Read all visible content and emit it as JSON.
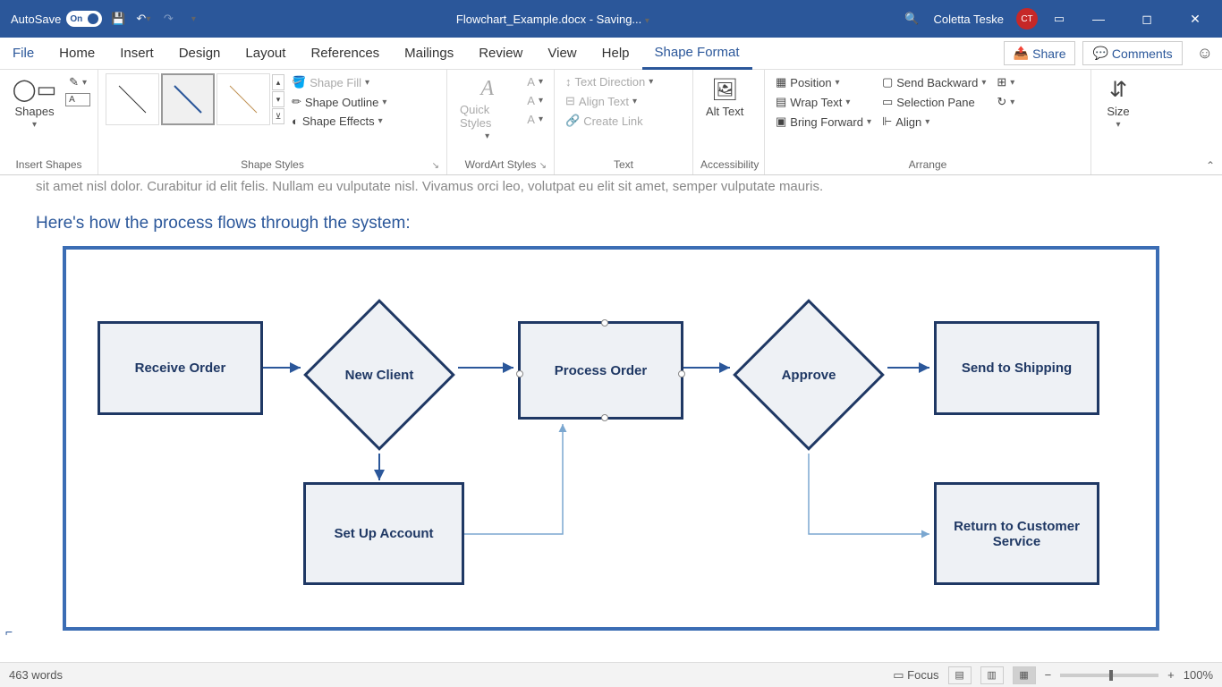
{
  "titlebar": {
    "autosave_label": "AutoSave",
    "autosave_state": "On",
    "doc_title": "Flowchart_Example.docx  -  Saving...",
    "user_name": "Coletta Teske",
    "user_initials": "CT"
  },
  "tabs": {
    "file": "File",
    "home": "Home",
    "insert": "Insert",
    "design": "Design",
    "layout": "Layout",
    "references": "References",
    "mailings": "Mailings",
    "review": "Review",
    "view": "View",
    "help": "Help",
    "shape_format": "Shape Format",
    "share": "Share",
    "comments": "Comments"
  },
  "ribbon": {
    "shapes": "Shapes",
    "insert_shapes": "Insert Shapes",
    "shape_styles": "Shape Styles",
    "shape_fill": "Shape Fill",
    "shape_outline": "Shape Outline",
    "shape_effects": "Shape Effects",
    "quick_styles": "Quick Styles",
    "wordart_styles": "WordArt Styles",
    "text_direction": "Text Direction",
    "align_text": "Align Text",
    "create_link": "Create Link",
    "text": "Text",
    "alt_text": "Alt Text",
    "accessibility": "Accessibility",
    "position": "Position",
    "wrap_text": "Wrap Text",
    "bring_forward": "Bring Forward",
    "send_backward": "Send Backward",
    "selection_pane": "Selection Pane",
    "align": "Align",
    "arrange": "Arrange",
    "size": "Size"
  },
  "document": {
    "body_text": "sit amet nisl dolor. Curabitur id elit felis. Nullam eu vulputate nisl. Vivamus orci leo, volutpat eu elit sit amet, semper vulputate mauris.",
    "heading": "Here's how the process flows through the system:"
  },
  "flowchart": {
    "receive_order": "Receive Order",
    "new_client": "New Client",
    "process_order": "Process Order",
    "approve": "Approve",
    "send_shipping": "Send to Shipping",
    "setup_account": "Set Up Account",
    "return_cs": "Return to Customer Service"
  },
  "statusbar": {
    "words": "463 words",
    "focus": "Focus",
    "zoom": "100%"
  }
}
